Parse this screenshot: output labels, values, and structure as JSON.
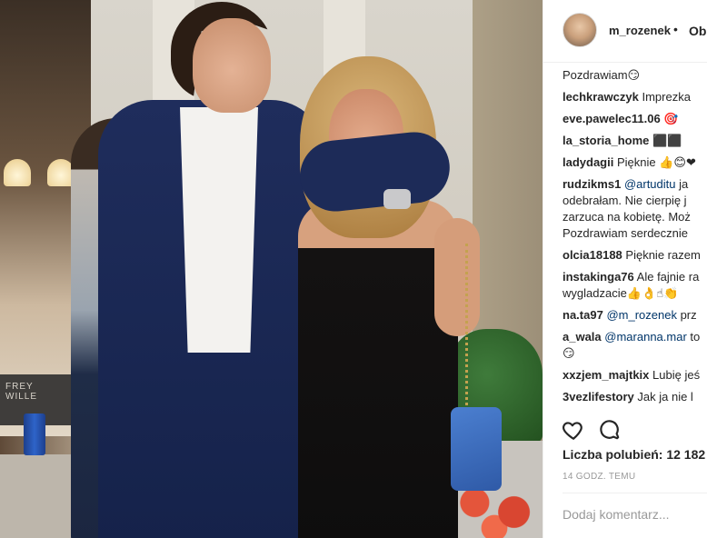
{
  "post": {
    "username": "m_rozenek",
    "separator": "•",
    "follow_label": "Ob"
  },
  "comments": [
    {
      "user": "",
      "lines": [
        "Pozdrawiam😏"
      ]
    },
    {
      "user": "lechkrawczyk",
      "lines": [
        "Imprezka"
      ]
    },
    {
      "user": "eve.pawelec11.06",
      "lines": [
        "🎯"
      ]
    },
    {
      "user": "la_storia_home",
      "lines": [
        "⬛⬛"
      ]
    },
    {
      "user": "ladydagii",
      "lines": [
        "Pięknie 👍😊❤"
      ]
    },
    {
      "user": "rudzikms1",
      "mention": "@artuditu",
      "lines": [
        "ja",
        "odebrałam. Nie cierpię j",
        "zarzuca na kobietę. Moż",
        "Pozdrawiam serdecznie"
      ]
    },
    {
      "user": "olcia18188",
      "lines": [
        "Pięknie razem"
      ]
    },
    {
      "user": "instakinga76",
      "lines": [
        "Ale fajnie ra",
        "wygladzacie👍👌☝👏"
      ]
    },
    {
      "user": "na.ta97",
      "mention": "@m_rozenek",
      "lines": [
        "prz"
      ]
    },
    {
      "user": "a_wala",
      "mention": "@maranna.mar",
      "lines": [
        "to",
        "😏"
      ]
    },
    {
      "user": "xxzjem_majtkix",
      "lines": [
        "Lubię jeś"
      ]
    },
    {
      "user": "3vezlifestory",
      "lines": [
        "Jak ja nie l"
      ]
    }
  ],
  "actions": {
    "like_icon": "heart-icon",
    "comment_icon": "comment-bubble-icon",
    "likes_text": "Liczba polubień: 12 182",
    "time_text": "14 GODZ. TEMU",
    "add_comment_placeholder": "Dodaj komentarz..."
  },
  "photo": {
    "shop_sign": "FREY WILLE"
  }
}
